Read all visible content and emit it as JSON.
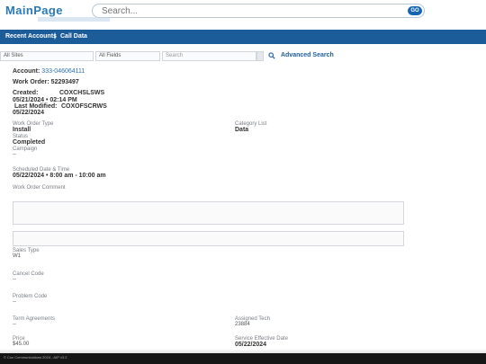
{
  "header": {
    "brand": "MainPage",
    "search_placeholder": "Search...",
    "go_label": "GO"
  },
  "nav": {
    "recent_accounts": "Recent Accounts",
    "separator": "|",
    "call_data": "Call Data"
  },
  "filters": {
    "sites": "All Sites",
    "fields": "All Fields",
    "search": "Search",
    "advanced_search": "Advanced Search"
  },
  "account": {
    "label": "Account:",
    "number": "333-046064111",
    "work_order_label": "Work Order:",
    "work_order_number": "52293497",
    "created_label": "Created:",
    "created_by": "COXCHSLSWS",
    "created_at": "05/21/2024 • 02:14 PM",
    "modified_label": "Last Modified:",
    "modified_by": "COXOFSCRWS",
    "modified_at": "05/22/2024"
  },
  "details": {
    "work_order_type_label": "Work Order Type",
    "work_order_type_value": "Install",
    "category_list_label": "Category List",
    "category_list_value": "Data",
    "status_label": "Status",
    "status_value": "Completed",
    "campaign_label": "Campaign",
    "campaign_value": "--",
    "scheduled_label": "Scheduled Date & Time",
    "scheduled_value": "05/22/2024 • 8:00 am - 10:00 am",
    "comment_label": "Work Order Comment",
    "sales_type_label": "Sales Type",
    "sales_type_value": "W1",
    "cancel_code_label": "Cancel Code",
    "cancel_code_value": "--",
    "problem_code_label": "Problem Code",
    "problem_code_value": "--",
    "term_agreements_label": "Term Agreements",
    "term_agreements_value": "--",
    "assigned_tech_label": "Assigned Tech",
    "assigned_tech_value": "23884",
    "price_label": "Price",
    "price_value": "$45.00",
    "service_effective_label": "Service Effective Date",
    "service_effective_value": "05/22/2024"
  },
  "footer": {
    "text": "© Cox Communications 2024 - AIP v3.2"
  },
  "colors": {
    "brand": "#2a7ab5",
    "nav": "#1b5c99",
    "go_button": "#1565b4",
    "footer": "#161616"
  }
}
